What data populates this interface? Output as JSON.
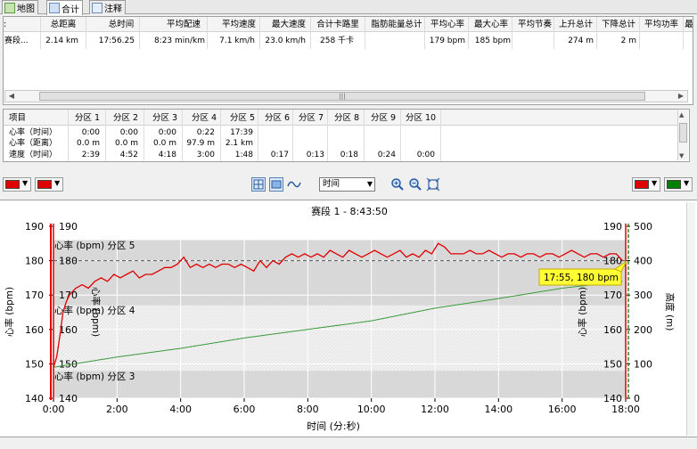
{
  "tabs": [
    {
      "label": "地图",
      "icon": "map-icon"
    },
    {
      "label": "合计",
      "icon": "table-icon"
    },
    {
      "label": "注释",
      "icon": "note-icon"
    }
  ],
  "summary": {
    "headers": [
      ":",
      "总距离",
      "总时间",
      "平均配速",
      "平均速度",
      "最大速度",
      "合计卡路里",
      "脂肪能量总计",
      "平均心率",
      "最大心率",
      "平均节奏",
      "上升总计",
      "下降总计",
      "平均功率",
      "最"
    ],
    "row": [
      "赛段...",
      "2.14 km",
      "17:56.25",
      "8:23 min/km",
      "7.1 km/h",
      "23.0 km/h",
      "258 千卡",
      "",
      "179 bpm",
      "185 bpm",
      "",
      "274 m",
      "2 m",
      "",
      ""
    ]
  },
  "zones": {
    "headers": [
      "项目",
      "分区 1",
      "分区 2",
      "分区 3",
      "分区 4",
      "分区 5",
      "分区 6",
      "分区 7",
      "分区 8",
      "分区 9",
      "分区 10"
    ],
    "rows": [
      [
        "心率（时间）",
        "0:00",
        "0:00",
        "0:00",
        "0:22",
        "17:39",
        "",
        "",
        "",
        "",
        ""
      ],
      [
        "心率（距离）",
        "0.0 m",
        "0.0 m",
        "0.0 m",
        "97.9 m",
        "2.1 km",
        "",
        "",
        "",
        "",
        ""
      ],
      [
        "速度（时间）",
        "2:39",
        "4:52",
        "4:18",
        "3:00",
        "1:48",
        "0:17",
        "0:13",
        "0:18",
        "0:24",
        "0:00"
      ]
    ]
  },
  "toolbar": {
    "x_axis_select": "时间",
    "left_colors": [
      "#e00000",
      "#e00000"
    ],
    "right_colors": [
      "#e00000",
      "#008000"
    ]
  },
  "chart": {
    "title": "赛段 1 - 8:43:50",
    "xlabel": "时间 (分:秒)",
    "ylabel_left": "心率 (bpm)",
    "ylabel_left_inner": "心率 (bpm)",
    "ylabel_right_inner": "心率 (bpm)",
    "ylabel_right": "高度 (m)",
    "zone_labels": [
      "心率 (bpm) 分区 5",
      "心率 (bpm) 分区 4",
      "心率 (bpm) 分区 3"
    ],
    "tooltip": "17:55, 180 bpm"
  },
  "chart_data": {
    "type": "line",
    "title": "赛段 1 - 8:43:50",
    "xlabel": "时间 (分:秒)",
    "x_ticks": [
      "0:00",
      "2:00",
      "4:00",
      "6:00",
      "8:00",
      "10:00",
      "12:00",
      "14:00",
      "16:00",
      "18:00"
    ],
    "xlim": [
      0,
      18
    ],
    "y_left": {
      "label": "心率 (bpm)",
      "ylim": [
        140,
        190
      ],
      "ticks": [
        140,
        150,
        160,
        170,
        180,
        190
      ]
    },
    "y_right": {
      "label": "高度 (m)",
      "ylim": [
        0,
        500
      ],
      "ticks": [
        0,
        100,
        200,
        300,
        400,
        500
      ]
    },
    "reference_line": 180,
    "zone_bands": [
      {
        "name": "心率 (bpm) 分区 3",
        "from": 140,
        "to": 148
      },
      {
        "name": "心率 (bpm) 分区 4",
        "from": 148,
        "to": 167
      },
      {
        "name": "心率 (bpm) 分区 5",
        "from": 167,
        "to": 186
      }
    ],
    "series": [
      {
        "name": "心率 (bpm)",
        "axis": "left",
        "color": "#e00000",
        "x": [
          0.0,
          0.1,
          0.2,
          0.3,
          0.4,
          0.5,
          0.6,
          0.7,
          0.9,
          1.1,
          1.3,
          1.5,
          1.7,
          1.9,
          2.1,
          2.3,
          2.5,
          2.7,
          2.9,
          3.1,
          3.3,
          3.5,
          3.7,
          3.9,
          4.1,
          4.3,
          4.5,
          4.7,
          4.9,
          5.1,
          5.3,
          5.5,
          5.7,
          5.9,
          6.1,
          6.3,
          6.5,
          6.7,
          6.9,
          7.1,
          7.3,
          7.5,
          7.7,
          7.9,
          8.1,
          8.3,
          8.5,
          8.7,
          8.9,
          9.1,
          9.3,
          9.5,
          9.7,
          9.9,
          10.1,
          10.3,
          10.5,
          10.7,
          10.9,
          11.1,
          11.3,
          11.5,
          11.7,
          11.9,
          12.1,
          12.3,
          12.5,
          12.7,
          12.9,
          13.1,
          13.3,
          13.5,
          13.7,
          13.9,
          14.1,
          14.3,
          14.5,
          14.7,
          14.9,
          15.1,
          15.3,
          15.5,
          15.7,
          15.9,
          16.1,
          16.3,
          16.5,
          16.7,
          16.9,
          17.1,
          17.3,
          17.5,
          17.7,
          17.9
        ],
        "y": [
          149,
          152,
          158,
          165,
          168,
          170,
          171,
          172,
          173,
          172,
          174,
          175,
          174,
          176,
          175,
          176,
          177,
          175,
          176,
          176,
          177,
          178,
          178,
          179,
          181,
          178,
          179,
          178,
          179,
          178,
          179,
          179,
          178,
          179,
          178,
          177,
          180,
          178,
          180,
          179,
          181,
          182,
          181,
          182,
          181,
          182,
          181,
          183,
          182,
          181,
          183,
          182,
          181,
          182,
          183,
          182,
          181,
          182,
          183,
          181,
          182,
          181,
          183,
          182,
          185,
          184,
          182,
          182,
          182,
          183,
          182,
          182,
          183,
          182,
          181,
          182,
          182,
          181,
          182,
          182,
          181,
          182,
          182,
          181,
          182,
          183,
          182,
          181,
          182,
          182,
          181,
          182,
          182,
          180
        ]
      },
      {
        "name": "高度 (m)",
        "axis": "right",
        "color": "#3a9a3a",
        "x": [
          0,
          2,
          4,
          6,
          8,
          10,
          12,
          14,
          16,
          17.9
        ],
        "y": [
          90,
          120,
          145,
          175,
          200,
          225,
          262,
          290,
          320,
          340
        ]
      }
    ]
  }
}
